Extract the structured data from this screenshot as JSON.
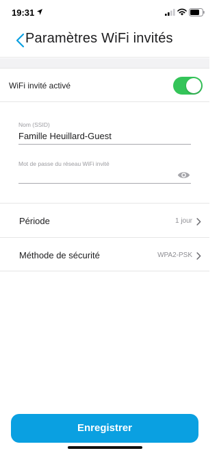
{
  "status_bar": {
    "time": "19:31"
  },
  "header": {
    "title": "Paramètres WiFi invités"
  },
  "guest_wifi": {
    "toggle_label": "WiFi invité activé",
    "enabled": true,
    "toggle_color": "#34c459"
  },
  "form": {
    "ssid_label": "Nom (SSID)",
    "ssid_value": "Famille Heuillard-Guest",
    "password_label": "Mot de passe du réseau WiFi invité",
    "password_value": ""
  },
  "settings": {
    "period_label": "Période",
    "period_value": "1 jour",
    "security_label": "Méthode de sécurité",
    "security_value": "WPA2-PSK"
  },
  "footer": {
    "save_label": "Enregistrer",
    "accent_color": "#0aa0e1"
  },
  "icons": [
    "location-arrow-icon",
    "cellular-signal-icon",
    "wifi-icon",
    "battery-icon",
    "back-chevron-icon",
    "eye-icon",
    "chevron-right-icon"
  ]
}
